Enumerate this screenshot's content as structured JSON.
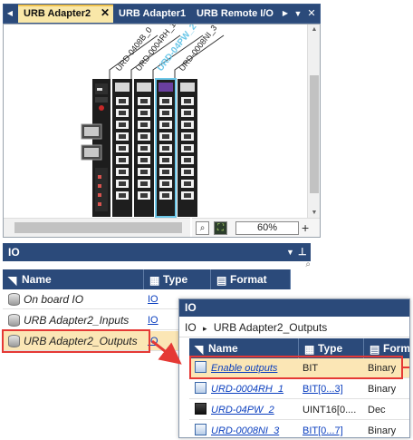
{
  "tabs": [
    {
      "label": "URB Adapter2",
      "active": true
    },
    {
      "label": "URB Adapter1",
      "active": false
    },
    {
      "label": "URB Remote I/O",
      "active": false
    }
  ],
  "diagram": {
    "module_labels": [
      "URD-0408B_0",
      "URD-0004RH_1",
      "URD-04PW_2",
      "URD-0008NI_3"
    ],
    "highlight_color": "#6cc7e8"
  },
  "zoom": {
    "value": "60%"
  },
  "io_panel": {
    "title": "IO",
    "columns": {
      "name": "Name",
      "type": "Type",
      "format": "Format"
    },
    "rows": [
      {
        "name": "On board IO",
        "type": "IO"
      },
      {
        "name": "URB Adapter2_Inputs",
        "type": "IO"
      },
      {
        "name": "URB Adapter2_Outputs",
        "type": "IO"
      }
    ]
  },
  "sub_panel": {
    "title": "IO",
    "breadcrumb_root": "IO",
    "breadcrumb_separator": "▸",
    "breadcrumb_leaf": "URB Adapter2_Outputs",
    "columns": {
      "name": "Name",
      "type": "Type",
      "format": "Form"
    },
    "rows": [
      {
        "name": "Enable outputs",
        "type": "BIT",
        "format": "Binary",
        "type_link": false
      },
      {
        "name": "URD-0004RH_1",
        "type": "BIT[0...3]",
        "format": "Binary",
        "type_link": true
      },
      {
        "name": "URD-04PW_2",
        "type": "UINT16[0....",
        "format": "Dec",
        "type_link": false
      },
      {
        "name": "URD-0008NI_3",
        "type": "BIT[0...7]",
        "format": "Binary",
        "type_link": true
      }
    ]
  },
  "colors": {
    "header": "#2b4a7a",
    "highlight": "#fbe6b5",
    "callout": "#e53935",
    "link": "#0b3fbf"
  }
}
